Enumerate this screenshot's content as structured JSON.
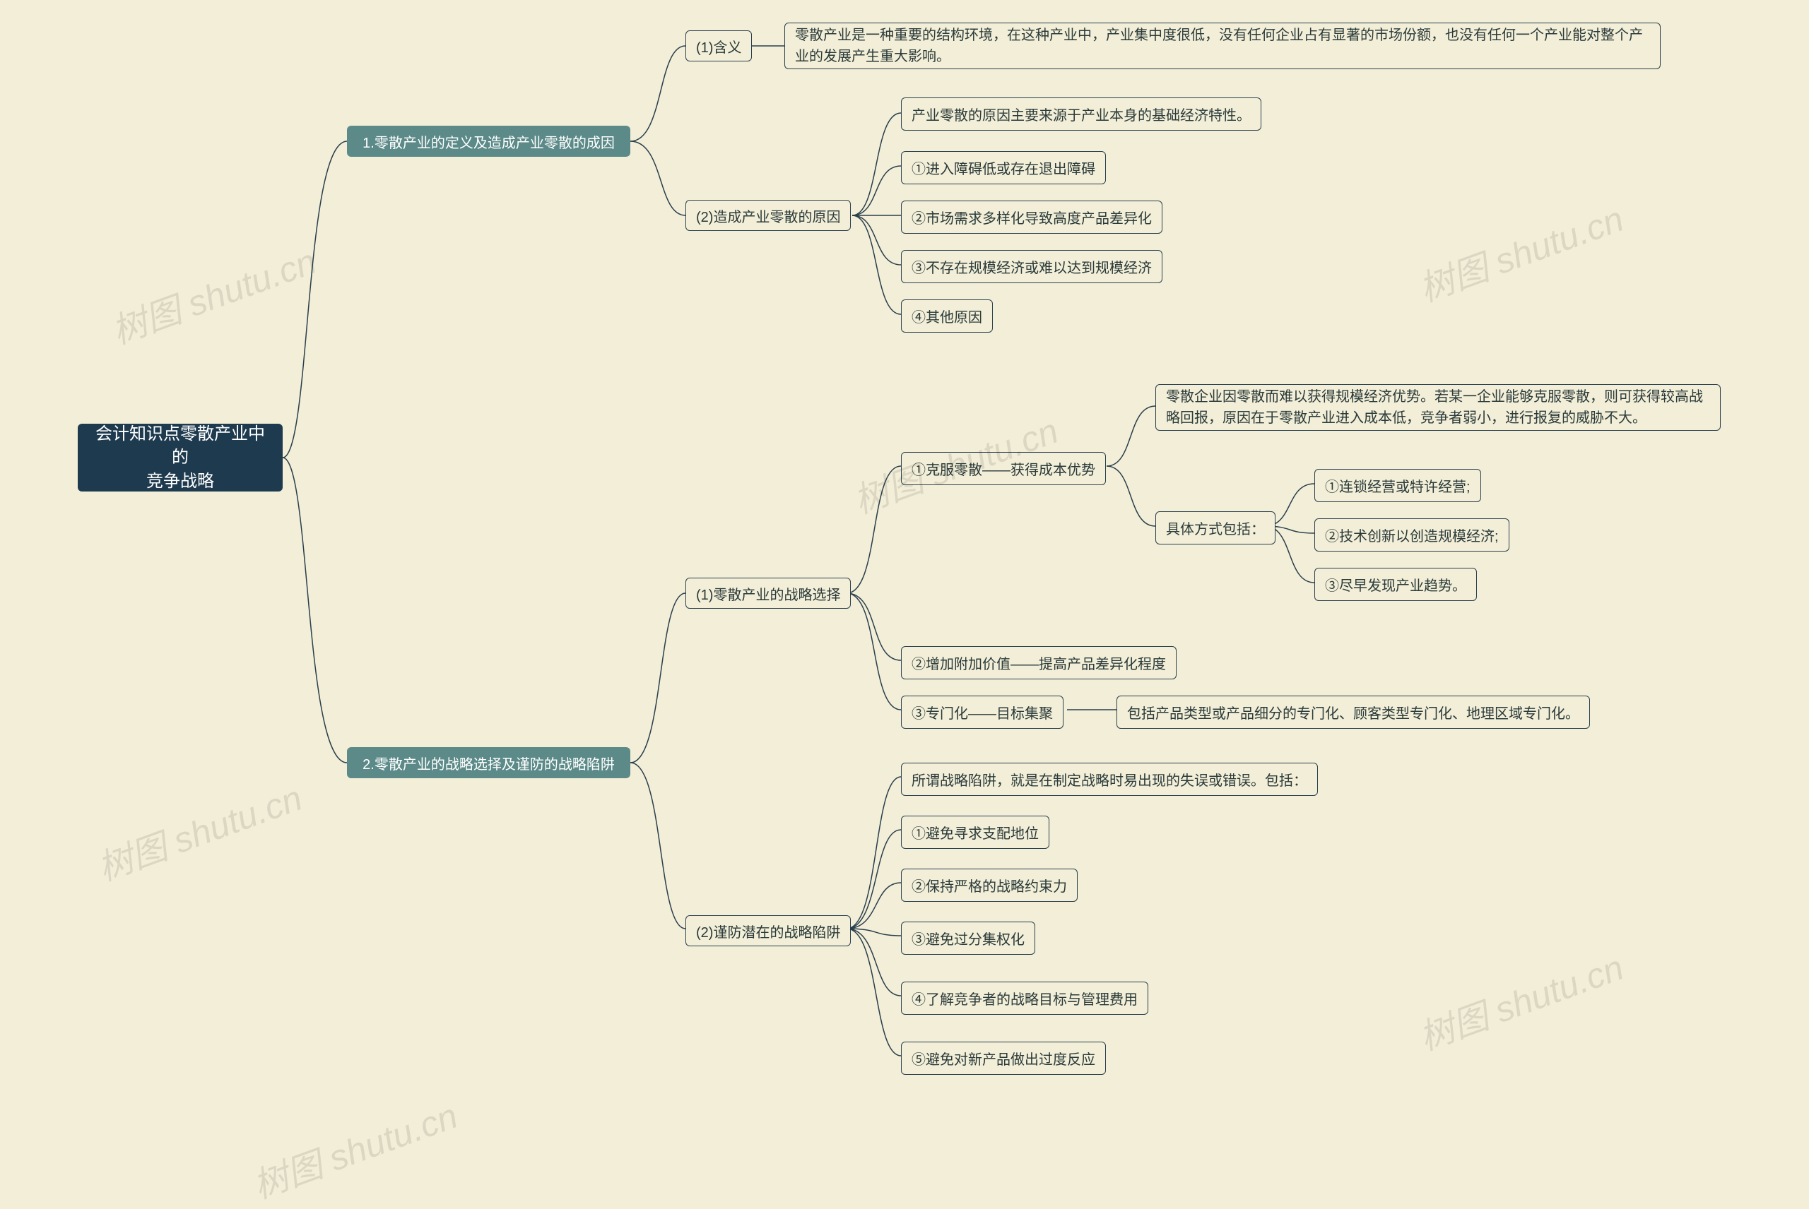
{
  "root": {
    "title": "会计知识点零散产业中的\n竞争战略"
  },
  "b1": {
    "label": "1.零散产业的定义及造成产业零散的成因"
  },
  "b2": {
    "label": "2.零散产业的战略选择及谨防的战略陷阱"
  },
  "b1_1": {
    "label": "(1)含义"
  },
  "b1_1_text": "零散产业是一种重要的结构环境，在这种产业中，产业集中度很低，没有任何企业占有显著的市场份额，也没有任何一个产业能对整个产业的发展产生重大影响。",
  "b1_2": {
    "label": "(2)造成产业零散的原因"
  },
  "b1_2_items": [
    "产业零散的原因主要来源于产业本身的基础经济特性。",
    "①进入障碍低或存在退出障碍",
    "②市场需求多样化导致高度产品差异化",
    "③不存在规模经济或难以达到规模经济",
    "④其他原因"
  ],
  "b2_1": {
    "label": "(1)零散产业的战略选择"
  },
  "b2_1_text": "零散企业因零散而难以获得规模经济优势。若某一企业能够克服零散，则可获得较高战略回报，原因在于零散产业进入成本低，竞争者弱小，进行报复的威胁不大。",
  "b2_1_items": {
    "a": "①克服零散——获得成本优势",
    "b": "②增加附加价值——提高产品差异化程度",
    "c": "③专门化——目标集聚",
    "c_detail": "包括产品类型或产品细分的专门化、顾客类型专门化、地理区域专门化。"
  },
  "b2_1_methods_label": "具体方式包括：",
  "b2_1_methods": [
    "①连锁经营或特许经营;",
    "②技术创新以创造规模经济;",
    "③尽早发现产业趋势。"
  ],
  "b2_2": {
    "label": "(2)谨防潜在的战略陷阱"
  },
  "b2_2_items": [
    "所谓战略陷阱，就是在制定战略时易出现的失误或错误。包括：",
    "①避免寻求支配地位",
    "②保持严格的战略约束力",
    "③避免过分集权化",
    "④了解竞争者的战略目标与管理费用",
    "⑤避免对新产品做出过度反应"
  ],
  "watermarks": [
    "树图 shutu.cn",
    "树图 shutu.cn",
    "树图 shutu.cn",
    "树图 shutu.cn",
    "树图 shutu.cn",
    "树图 shutu.cn"
  ]
}
